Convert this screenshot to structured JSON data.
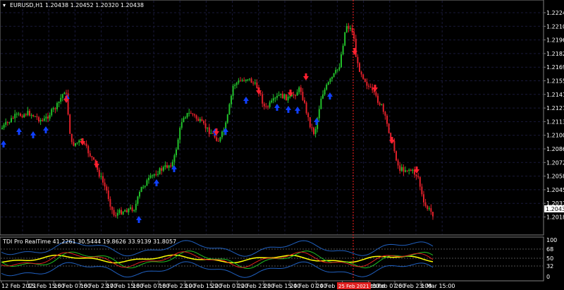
{
  "chart_header": {
    "symbol_label": "EURUSD,H1",
    "ohlc": "1.20438 1.20452 1.20320 1.20438"
  },
  "price_axis": {
    "ticks": [
      "1.22240",
      "1.22100",
      "1.21960",
      "1.21825",
      "1.21690",
      "1.21550",
      "1.21415",
      "1.21275",
      "1.21135",
      "1.21000",
      "1.20860",
      "1.20725",
      "1.20585",
      "1.20450",
      "1.20315",
      "1.20180"
    ],
    "current_price": "1.20436"
  },
  "indicator": {
    "title": "TDI Pro RealTime 41.2261 30.5444 19.8626 33.9139 31.8057",
    "levels": [
      "100",
      "68",
      "50",
      "32",
      "0"
    ]
  },
  "time_axis": {
    "labels": [
      "12 Feb 2021",
      "15 Feb 15:00",
      "16 Feb 07:00",
      "16 Feb 23:00",
      "17 Feb 15:00",
      "18 Feb 07:00",
      "18 Feb 23:00",
      "19 Feb 15:00",
      "22 Feb 07:00",
      "22 Feb 23:00",
      "23 Feb 15:00",
      "24 Feb 07:00",
      "24 Feb 23:00",
      "25 Feb 15:00",
      "26 Feb 07:00",
      "26 Feb 23:00",
      "1 Mar 15:00"
    ],
    "highlight_label": "25 Feb 2021 03:00"
  },
  "colors": {
    "bull": "#22c02a",
    "bear": "#e0202a",
    "buy_arrow": "#1040ff",
    "sell_arrow": "#ff2030",
    "grid": "#1a1a3a"
  }
}
